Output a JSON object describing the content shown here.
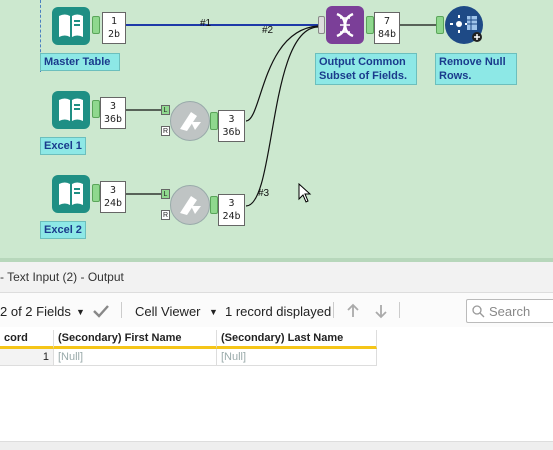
{
  "workflow": {
    "tools": {
      "master_table": {
        "label": "Master Table",
        "count": "1",
        "size": "2b"
      },
      "excel1": {
        "label": "Excel 1",
        "count": "3",
        "size": "36b"
      },
      "excel2": {
        "label": "Excel 2",
        "count": "3",
        "size": "24b"
      },
      "join1": {
        "count": "3",
        "size": "36b"
      },
      "join2": {
        "count": "3",
        "size": "24b"
      },
      "dna": {
        "label": "Output Common Subset of Fields.",
        "count": "7",
        "size": "84b"
      },
      "remove_null": {
        "label": "Remove Null Rows."
      }
    },
    "wire_labels": {
      "w1": "#1",
      "w2": "#2",
      "w3": "#3"
    },
    "anchor_labels": {
      "left": "L",
      "right": "R"
    }
  },
  "results": {
    "title": "Text Input (2) - Output",
    "fields_selector": "2 of 2 Fields",
    "viewer": "Cell Viewer",
    "records": "1 record displayed",
    "search_placeholder": "Search",
    "columns": [
      "cord",
      "(Secondary) First Name",
      "(Secondary) Last Name"
    ],
    "rows": [
      {
        "record": "1",
        "first": "[Null]",
        "last": "[Null]"
      }
    ]
  },
  "colors": {
    "canvas": "#cce8cf",
    "label_bg": "#8de8e6",
    "header_accent": "#f5c518",
    "dna_purple": "#7b3f98"
  }
}
